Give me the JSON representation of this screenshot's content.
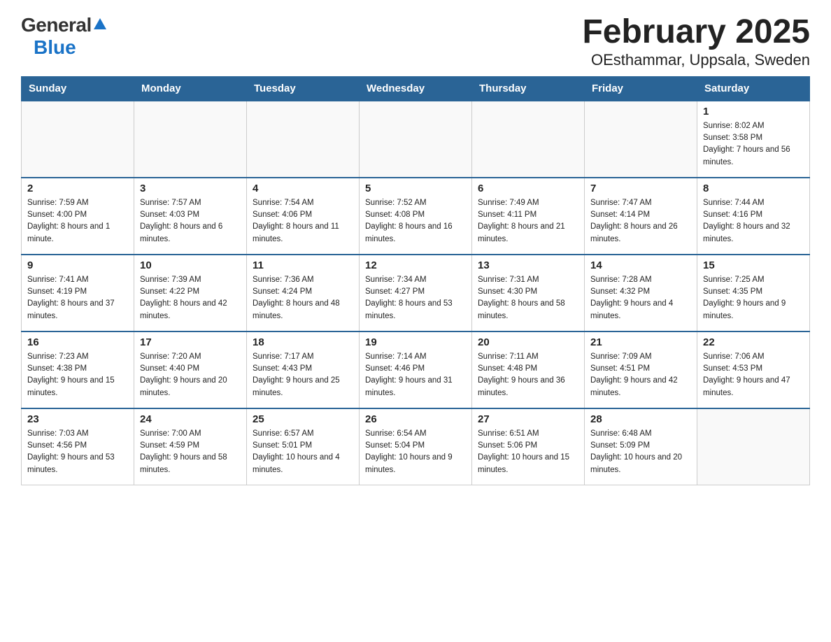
{
  "logo": {
    "general": "General",
    "blue": "Blue"
  },
  "title": "February 2025",
  "subtitle": "OEsthammar, Uppsala, Sweden",
  "weekdays": [
    "Sunday",
    "Monday",
    "Tuesday",
    "Wednesday",
    "Thursday",
    "Friday",
    "Saturday"
  ],
  "weeks": [
    [
      {
        "day": "",
        "sunrise": "",
        "sunset": "",
        "daylight": ""
      },
      {
        "day": "",
        "sunrise": "",
        "sunset": "",
        "daylight": ""
      },
      {
        "day": "",
        "sunrise": "",
        "sunset": "",
        "daylight": ""
      },
      {
        "day": "",
        "sunrise": "",
        "sunset": "",
        "daylight": ""
      },
      {
        "day": "",
        "sunrise": "",
        "sunset": "",
        "daylight": ""
      },
      {
        "day": "",
        "sunrise": "",
        "sunset": "",
        "daylight": ""
      },
      {
        "day": "1",
        "sunrise": "Sunrise: 8:02 AM",
        "sunset": "Sunset: 3:58 PM",
        "daylight": "Daylight: 7 hours and 56 minutes."
      }
    ],
    [
      {
        "day": "2",
        "sunrise": "Sunrise: 7:59 AM",
        "sunset": "Sunset: 4:00 PM",
        "daylight": "Daylight: 8 hours and 1 minute."
      },
      {
        "day": "3",
        "sunrise": "Sunrise: 7:57 AM",
        "sunset": "Sunset: 4:03 PM",
        "daylight": "Daylight: 8 hours and 6 minutes."
      },
      {
        "day": "4",
        "sunrise": "Sunrise: 7:54 AM",
        "sunset": "Sunset: 4:06 PM",
        "daylight": "Daylight: 8 hours and 11 minutes."
      },
      {
        "day": "5",
        "sunrise": "Sunrise: 7:52 AM",
        "sunset": "Sunset: 4:08 PM",
        "daylight": "Daylight: 8 hours and 16 minutes."
      },
      {
        "day": "6",
        "sunrise": "Sunrise: 7:49 AM",
        "sunset": "Sunset: 4:11 PM",
        "daylight": "Daylight: 8 hours and 21 minutes."
      },
      {
        "day": "7",
        "sunrise": "Sunrise: 7:47 AM",
        "sunset": "Sunset: 4:14 PM",
        "daylight": "Daylight: 8 hours and 26 minutes."
      },
      {
        "day": "8",
        "sunrise": "Sunrise: 7:44 AM",
        "sunset": "Sunset: 4:16 PM",
        "daylight": "Daylight: 8 hours and 32 minutes."
      }
    ],
    [
      {
        "day": "9",
        "sunrise": "Sunrise: 7:41 AM",
        "sunset": "Sunset: 4:19 PM",
        "daylight": "Daylight: 8 hours and 37 minutes."
      },
      {
        "day": "10",
        "sunrise": "Sunrise: 7:39 AM",
        "sunset": "Sunset: 4:22 PM",
        "daylight": "Daylight: 8 hours and 42 minutes."
      },
      {
        "day": "11",
        "sunrise": "Sunrise: 7:36 AM",
        "sunset": "Sunset: 4:24 PM",
        "daylight": "Daylight: 8 hours and 48 minutes."
      },
      {
        "day": "12",
        "sunrise": "Sunrise: 7:34 AM",
        "sunset": "Sunset: 4:27 PM",
        "daylight": "Daylight: 8 hours and 53 minutes."
      },
      {
        "day": "13",
        "sunrise": "Sunrise: 7:31 AM",
        "sunset": "Sunset: 4:30 PM",
        "daylight": "Daylight: 8 hours and 58 minutes."
      },
      {
        "day": "14",
        "sunrise": "Sunrise: 7:28 AM",
        "sunset": "Sunset: 4:32 PM",
        "daylight": "Daylight: 9 hours and 4 minutes."
      },
      {
        "day": "15",
        "sunrise": "Sunrise: 7:25 AM",
        "sunset": "Sunset: 4:35 PM",
        "daylight": "Daylight: 9 hours and 9 minutes."
      }
    ],
    [
      {
        "day": "16",
        "sunrise": "Sunrise: 7:23 AM",
        "sunset": "Sunset: 4:38 PM",
        "daylight": "Daylight: 9 hours and 15 minutes."
      },
      {
        "day": "17",
        "sunrise": "Sunrise: 7:20 AM",
        "sunset": "Sunset: 4:40 PM",
        "daylight": "Daylight: 9 hours and 20 minutes."
      },
      {
        "day": "18",
        "sunrise": "Sunrise: 7:17 AM",
        "sunset": "Sunset: 4:43 PM",
        "daylight": "Daylight: 9 hours and 25 minutes."
      },
      {
        "day": "19",
        "sunrise": "Sunrise: 7:14 AM",
        "sunset": "Sunset: 4:46 PM",
        "daylight": "Daylight: 9 hours and 31 minutes."
      },
      {
        "day": "20",
        "sunrise": "Sunrise: 7:11 AM",
        "sunset": "Sunset: 4:48 PM",
        "daylight": "Daylight: 9 hours and 36 minutes."
      },
      {
        "day": "21",
        "sunrise": "Sunrise: 7:09 AM",
        "sunset": "Sunset: 4:51 PM",
        "daylight": "Daylight: 9 hours and 42 minutes."
      },
      {
        "day": "22",
        "sunrise": "Sunrise: 7:06 AM",
        "sunset": "Sunset: 4:53 PM",
        "daylight": "Daylight: 9 hours and 47 minutes."
      }
    ],
    [
      {
        "day": "23",
        "sunrise": "Sunrise: 7:03 AM",
        "sunset": "Sunset: 4:56 PM",
        "daylight": "Daylight: 9 hours and 53 minutes."
      },
      {
        "day": "24",
        "sunrise": "Sunrise: 7:00 AM",
        "sunset": "Sunset: 4:59 PM",
        "daylight": "Daylight: 9 hours and 58 minutes."
      },
      {
        "day": "25",
        "sunrise": "Sunrise: 6:57 AM",
        "sunset": "Sunset: 5:01 PM",
        "daylight": "Daylight: 10 hours and 4 minutes."
      },
      {
        "day": "26",
        "sunrise": "Sunrise: 6:54 AM",
        "sunset": "Sunset: 5:04 PM",
        "daylight": "Daylight: 10 hours and 9 minutes."
      },
      {
        "day": "27",
        "sunrise": "Sunrise: 6:51 AM",
        "sunset": "Sunset: 5:06 PM",
        "daylight": "Daylight: 10 hours and 15 minutes."
      },
      {
        "day": "28",
        "sunrise": "Sunrise: 6:48 AM",
        "sunset": "Sunset: 5:09 PM",
        "daylight": "Daylight: 10 hours and 20 minutes."
      },
      {
        "day": "",
        "sunrise": "",
        "sunset": "",
        "daylight": ""
      }
    ]
  ]
}
